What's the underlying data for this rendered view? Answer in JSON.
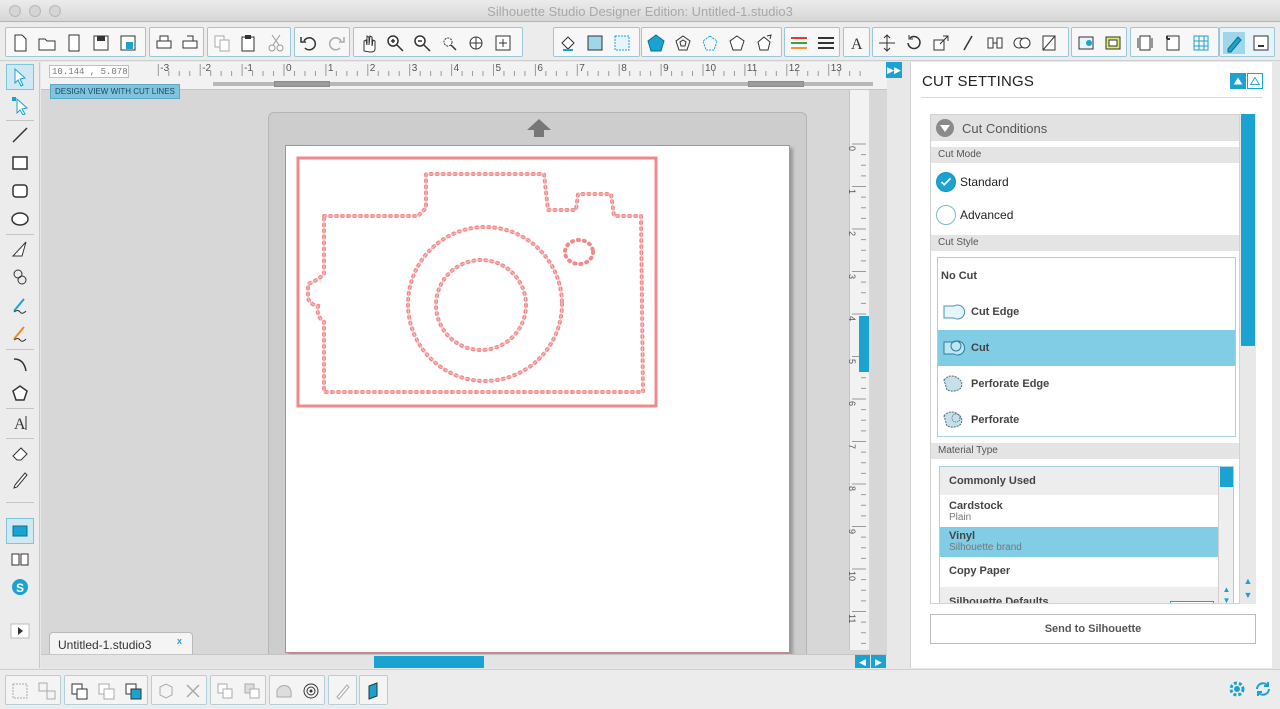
{
  "window": {
    "title": "Silhouette Studio Designer Edition: Untitled-1.studio3"
  },
  "canvas": {
    "coordinate_readout": "10.144 , 5.078",
    "view_mode_label": "DESIGN VIEW WITH CUT LINES",
    "ruler_h_labels": [
      "-3",
      "-2",
      "-1",
      "0",
      "1",
      "2",
      "3",
      "4",
      "5",
      "6",
      "7",
      "8",
      "9",
      "10",
      "11",
      "12",
      "13"
    ],
    "ruler_v_labels": [
      "0",
      "1",
      "2",
      "3",
      "4",
      "5",
      "6",
      "7",
      "8",
      "9",
      "10",
      "11"
    ],
    "document_tab": "Untitled-1.studio3",
    "document_tab_close": "x",
    "cut_line_color": "#f08a8a"
  },
  "cut_settings": {
    "title": "CUT SETTINGS",
    "section_title": "Cut Conditions",
    "cut_mode_label": "Cut Mode",
    "modes": [
      {
        "label": "Standard",
        "selected": true
      },
      {
        "label": "Advanced",
        "selected": false
      }
    ],
    "cut_style_label": "Cut Style",
    "styles": [
      {
        "label": "No Cut",
        "selected": false
      },
      {
        "label": "Cut Edge",
        "selected": false
      },
      {
        "label": "Cut",
        "selected": true
      },
      {
        "label": "Perforate Edge",
        "selected": false
      },
      {
        "label": "Perforate",
        "selected": false
      }
    ],
    "material_type_label": "Material Type",
    "materials": [
      {
        "name": "Commonly Used",
        "sub": "",
        "group": true
      },
      {
        "name": "Cardstock",
        "sub": "Plain",
        "group": false
      },
      {
        "name": "Vinyl",
        "sub": "Silhouette brand",
        "group": false,
        "selected": true
      },
      {
        "name": "Copy Paper",
        "sub": "",
        "group": false
      },
      {
        "name": "Silhouette Defaults",
        "sub": "",
        "group": true
      }
    ],
    "send_button": "Send to Silhouette"
  },
  "colors": {
    "accent": "#1aa3d0",
    "selection": "#81cde6"
  }
}
